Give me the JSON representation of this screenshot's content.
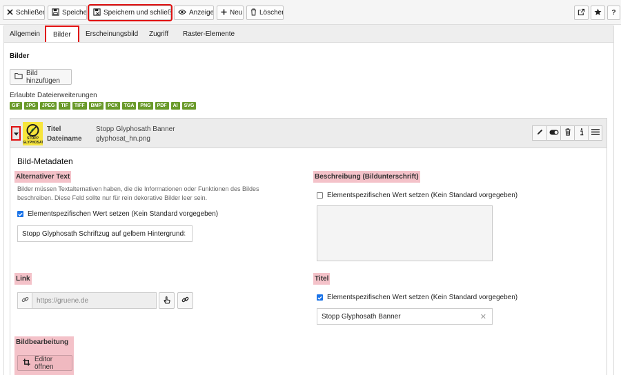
{
  "toolbar": {
    "close_label": "Schließen",
    "save_label": "Speichern",
    "save_close_label": "Speichern und schließen",
    "preview_label": "Anzeigen",
    "new_label": "Neu",
    "delete_label": "Löschen",
    "help_label": "?"
  },
  "tabs": [
    {
      "label": "Allgemein"
    },
    {
      "label": "Bilder"
    },
    {
      "label": "Erscheinungsbild"
    },
    {
      "label": "Zugriff"
    },
    {
      "label": "Raster-Elemente"
    }
  ],
  "images": {
    "heading": "Bilder",
    "add_label": "Bild hinzufügen",
    "extensions_label": "Erlaubte Dateierweiterungen",
    "extensions": [
      "GIF",
      "JPG",
      "JPEG",
      "TIF",
      "TIFF",
      "BMP",
      "PCX",
      "TGA",
      "PNG",
      "PDF",
      "AI",
      "SVG"
    ],
    "badge_color": "#6a9a2a"
  },
  "file": {
    "title_label": "Titel",
    "title_value": "Stopp Glyphosath Banner",
    "filename_label": "Dateiname",
    "filename_value": "glyphosat_hn.png",
    "thumb_text": "STOPP GLYPHOSAT"
  },
  "meta": {
    "heading": "Bild-Metadaten",
    "alt_label": "Alternativer Text",
    "alt_help_1": "Bilder müssen Textalternativen haben, die die Informationen oder Funktionen des Bildes",
    "alt_help_2": "beschreiben. Diese Feld sollte nur für rein dekorative Bilder leer sein.",
    "alt_checkbox": "Elementspezifischen Wert setzen (Kein Standard vorgegeben)",
    "alt_value": "Stopp Glyphosath Schriftzug auf gelbem Hintergrund",
    "desc_label": "Beschreibung (Bildunterschrift)",
    "desc_checkbox": "Elementspezifischen Wert setzen (Kein Standard vorgegeben)",
    "link_label": "Link",
    "link_placeholder": "https://gruene.de",
    "title_label": "Titel",
    "title_checkbox": "Elementspezifischen Wert setzen (Kein Standard vorgegeben)",
    "title_value": "Stopp Glyphosath Banner",
    "edit_label": "Bildbearbeitung",
    "editor_button": "Editor öffnen",
    "highlight_color": "#f4c2c9"
  }
}
